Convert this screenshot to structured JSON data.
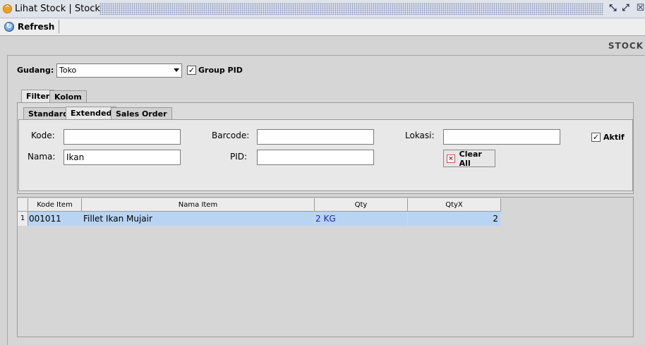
{
  "window": {
    "title": "Lihat Stock | Stock"
  },
  "toolbar": {
    "refresh_label": "Refresh"
  },
  "section_label": "STOCK",
  "filters": {
    "gudang_label": "Gudang:",
    "gudang_value": "Toko",
    "group_pid_label": "Group PID",
    "group_pid_checked": true
  },
  "outer_tabs": [
    "Filter",
    "Kolom"
  ],
  "inner_tabs": [
    "Standard",
    "Extended",
    "Sales Order"
  ],
  "form": {
    "kode_label": "Kode:",
    "kode_value": "",
    "nama_label": "Nama:",
    "nama_value": "Ikan",
    "barcode_label": "Barcode:",
    "barcode_value": "",
    "pid_label": "PID:",
    "pid_value": "",
    "lokasi_label": "Lokasi:",
    "lokasi_value": "",
    "aktif_label": "Aktif",
    "aktif_checked": true,
    "clear_label": "Clear All"
  },
  "table": {
    "columns": [
      "Kode Item",
      "Nama Item",
      "Qty",
      "QtyX"
    ],
    "rows": [
      {
        "no": "1",
        "kode": "001011",
        "nama": "Fillet Ikan Mujair",
        "qty": "2 KG",
        "qtyx": "2"
      }
    ]
  }
}
